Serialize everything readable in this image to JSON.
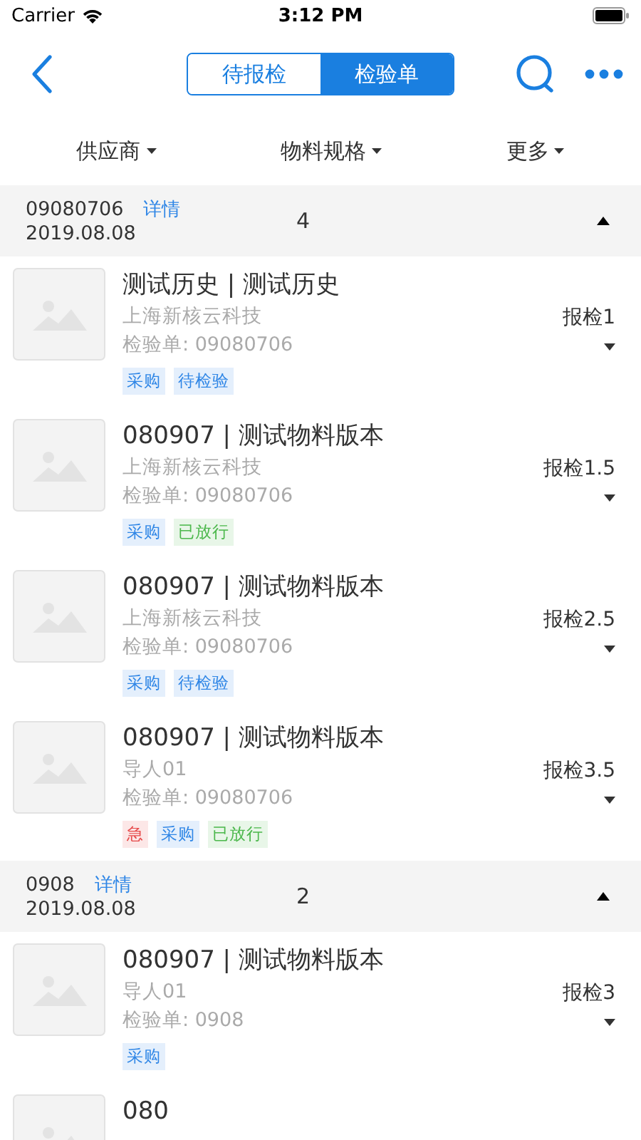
{
  "status_bar": {
    "carrier": "Carrier",
    "time": "3:12 PM"
  },
  "segments": [
    {
      "label": "待报检",
      "selected": false
    },
    {
      "label": "检验单",
      "selected": true
    }
  ],
  "filters": [
    "供应商",
    "物料规格",
    "更多"
  ],
  "groups": [
    {
      "code": "09080706",
      "link": "详情",
      "date": "2019.08.08",
      "count": "4",
      "expanded": true,
      "items": [
        {
          "title": "测试历史 | 测试历史",
          "subtitle": "上海新核云科技",
          "order": "检验单: 09080706",
          "right": "报检1",
          "tags": [
            {
              "label": "采购",
              "color": "#2f86e6"
            },
            {
              "label": "待检验",
              "color": "#2f86e6"
            }
          ]
        },
        {
          "title": "080907 | 测试物料版本",
          "subtitle": "上海新核云科技",
          "order": "检验单: 09080706",
          "right": "报检1.5",
          "tags": [
            {
              "label": "采购",
              "color": "#2f86e6"
            },
            {
              "label": "已放行",
              "color": "#4cb84c"
            }
          ]
        },
        {
          "title": "080907 | 测试物料版本",
          "subtitle": "上海新核云科技",
          "order": "检验单: 09080706",
          "right": "报检2.5",
          "tags": [
            {
              "label": "采购",
              "color": "#2f86e6"
            },
            {
              "label": "待检验",
              "color": "#2f86e6"
            }
          ]
        },
        {
          "title": "080907 | 测试物料版本",
          "subtitle": "导人01",
          "order": "检验单: 09080706",
          "right": "报检3.5",
          "tags": [
            {
              "label": "急",
              "color": "#e64848"
            },
            {
              "label": "采购",
              "color": "#2f86e6"
            },
            {
              "label": "已放行",
              "color": "#4cb84c"
            }
          ]
        }
      ]
    },
    {
      "code": "0908",
      "link": "详情",
      "date": "2019.08.08",
      "count": "2",
      "expanded": true,
      "items": [
        {
          "title": "080907 | 测试物料版本",
          "subtitle": "导人01",
          "order": "检验单: 0908",
          "right": "报检3",
          "tags": [
            {
              "label": "采购",
              "color": "#2f86e6"
            }
          ]
        },
        {
          "title": "080"
        }
      ]
    }
  ]
}
